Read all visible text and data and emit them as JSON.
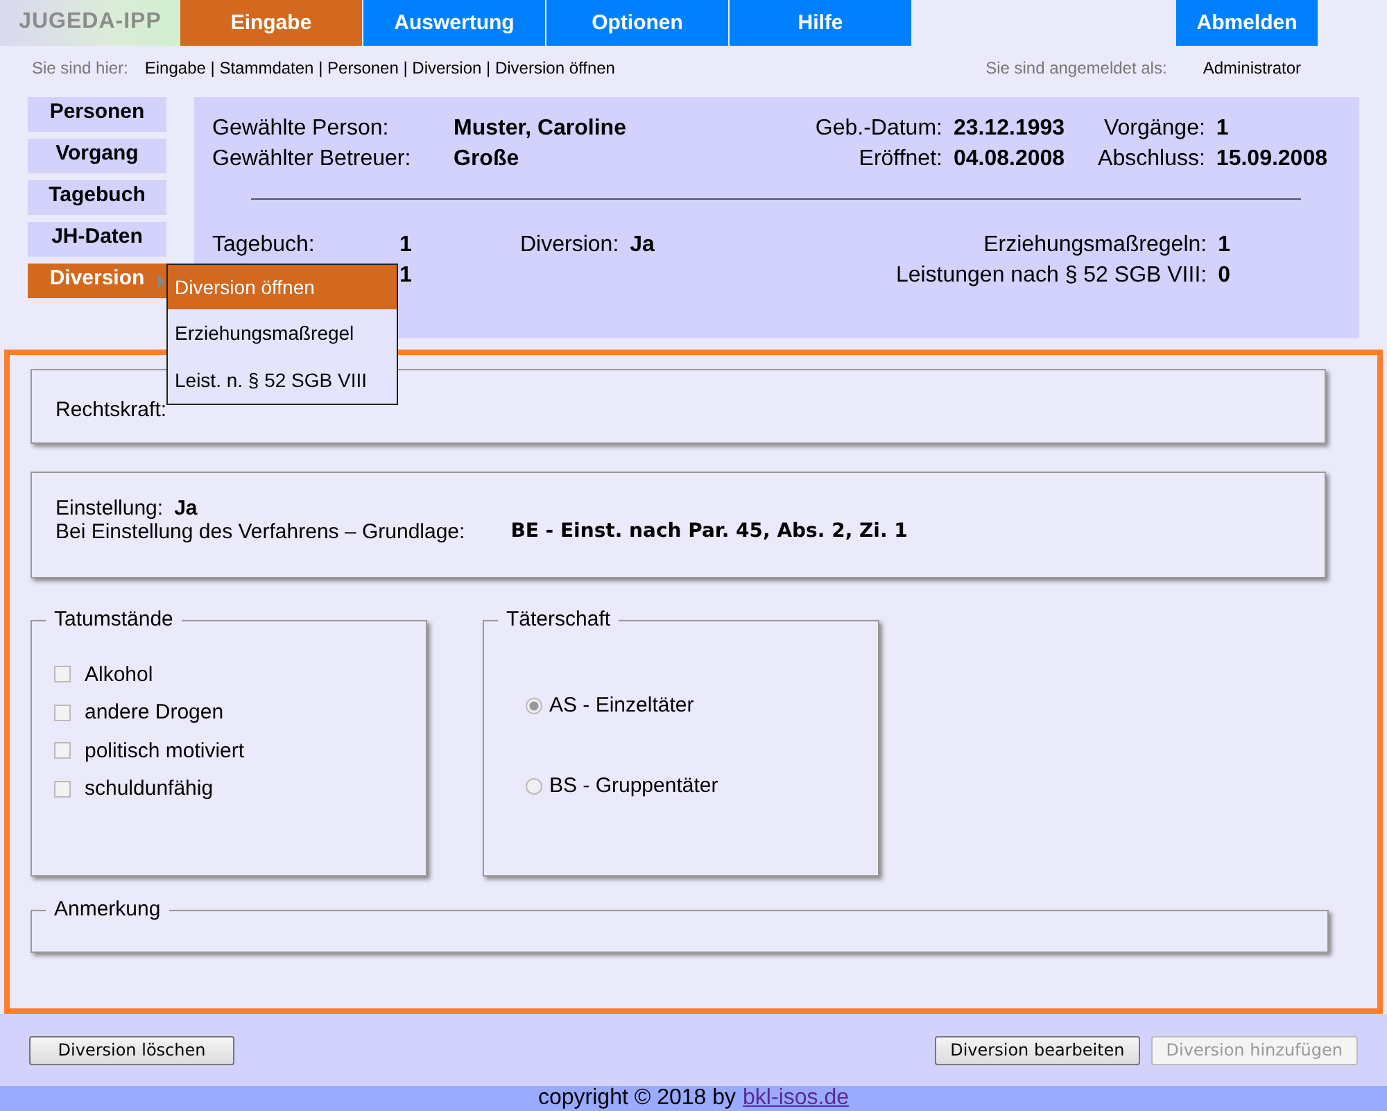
{
  "logo": "JUGEDA-IPP",
  "nav": [
    {
      "label": "Eingabe",
      "selected": true
    },
    {
      "label": "Auswertung",
      "selected": false
    },
    {
      "label": "Optionen",
      "selected": false
    },
    {
      "label": "Hilfe",
      "selected": false
    }
  ],
  "logout": "Abmelden",
  "breadcrumb": {
    "label": "Sie sind hier:",
    "path": "Eingabe | Stammdaten | Personen | Diversion | Diversion öffnen"
  },
  "login": {
    "label": "Sie sind angemeldet als:",
    "user": "Administrator"
  },
  "sidebar": {
    "items": [
      {
        "label": "Personen",
        "selected": false
      },
      {
        "label": "Vorgang",
        "selected": false
      },
      {
        "label": "Tagebuch",
        "selected": false
      },
      {
        "label": "JH-Daten",
        "selected": false
      },
      {
        "label": "Diversion",
        "selected": true
      }
    ]
  },
  "submenu": [
    {
      "label": "Diversion öffnen",
      "selected": true
    },
    {
      "label": "Erziehungsmaßregel",
      "selected": false
    },
    {
      "label": "Leist. n. § 52 SGB VIII",
      "selected": false
    }
  ],
  "info": {
    "person": [
      {
        "label": "Gewählte Person:",
        "value": "Muster, Caroline"
      },
      {
        "label": "Gewählter Betreuer:",
        "value": "Große"
      }
    ],
    "dates": [
      {
        "label": "Geb.-Datum:",
        "value": "23.12.1993"
      },
      {
        "label": "Vorgänge:",
        "value": "1"
      },
      {
        "label": "Eröffnet:",
        "value": "04.08.2008"
      },
      {
        "label": "Abschluss:",
        "value": "15.09.2008"
      }
    ],
    "counts": [
      {
        "label": "Tagebuch:",
        "value": "1"
      },
      {
        "value": "1"
      }
    ],
    "diversion": {
      "label": "Diversion:",
      "value": "Ja"
    },
    "measures": [
      {
        "label": "Erziehungsmaßregeln:",
        "value": "1"
      },
      {
        "label": "Leistungen nach § 52 SGB VIII:",
        "value": "0"
      }
    ]
  },
  "rechtskraft": {
    "label": "Rechtskraft:"
  },
  "einstellung": {
    "label": "Einstellung:",
    "value": "Ja",
    "basis_label": "Bei Einstellung des Verfahrens – Grundlage:",
    "basis": "BE - Einst. nach Par. 45, Abs. 2,  Zi. 1"
  },
  "tatumstaende": {
    "title": "Tatumstände",
    "items": [
      {
        "label": "Alkohol",
        "checked": false
      },
      {
        "label": "andere Drogen",
        "checked": false
      },
      {
        "label": "politisch motiviert",
        "checked": false
      },
      {
        "label": "schuldunfähig",
        "checked": false
      }
    ]
  },
  "taeterschaft": {
    "title": "Täterschaft",
    "options": [
      {
        "label": "AS - Einzeltäter",
        "selected": true
      },
      {
        "label": "BS - Gruppentäter",
        "selected": false
      }
    ]
  },
  "anmerkung": {
    "title": "Anmerkung"
  },
  "buttons": {
    "left": [
      {
        "label": "Diversion löschen",
        "disabled": false
      }
    ],
    "right": [
      {
        "label": "Diversion bearbeiten",
        "disabled": false
      },
      {
        "label": "Diversion hinzufügen",
        "disabled": true
      }
    ]
  },
  "footer": {
    "text": "copyright © 2018 by",
    "link": "bkl-isos.de"
  }
}
